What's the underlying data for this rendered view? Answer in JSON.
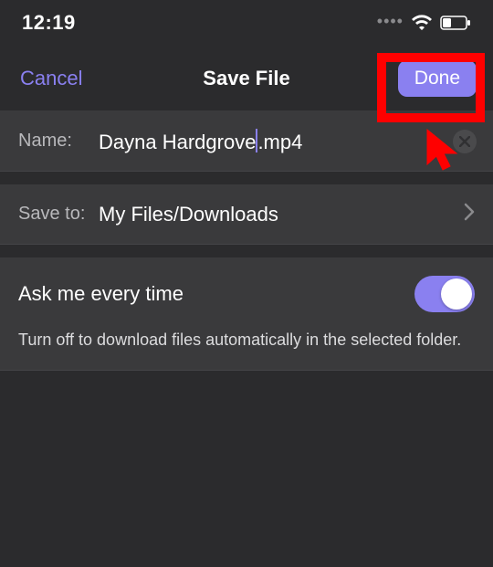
{
  "status": {
    "time": "12:19"
  },
  "header": {
    "cancel_label": "Cancel",
    "title": "Save File",
    "done_label": "Done"
  },
  "name_row": {
    "label": "Name:",
    "value_before_caret": "Dayna Hardgrove",
    "value_after_caret": ".mp4"
  },
  "saveto_row": {
    "label": "Save to:",
    "value": "My Files/Downloads"
  },
  "ask_row": {
    "label": "Ask me every time",
    "enabled": true,
    "description": "Turn off to download files automatically in the selected folder."
  }
}
